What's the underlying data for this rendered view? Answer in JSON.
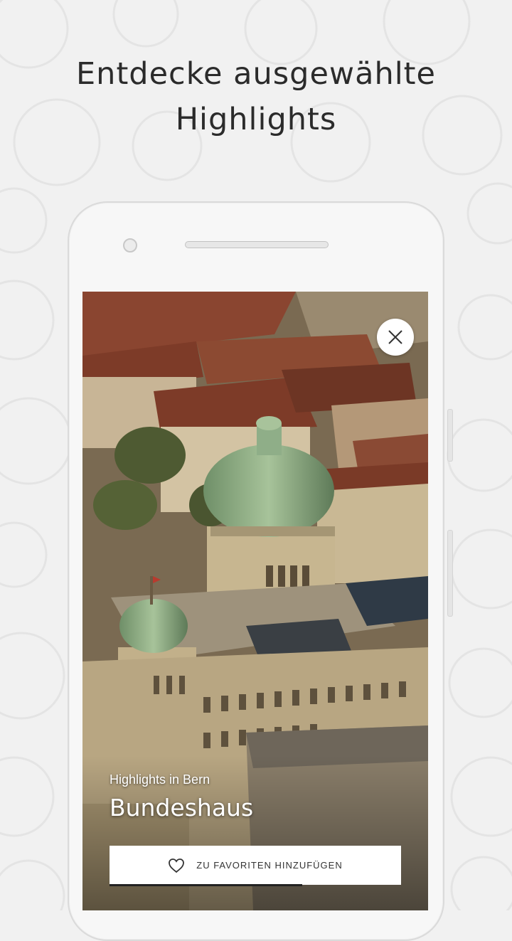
{
  "headline": {
    "line1": "Entdecke ausgewählte",
    "line2": "Highlights"
  },
  "screen": {
    "subtitle": "Highlights in Bern",
    "title": "Bundeshaus",
    "favorite_label": "ZU FAVORITEN HINZUFÜGEN",
    "progress": 0.66,
    "icons": {
      "close": "close-icon",
      "favorite": "heart-icon"
    }
  },
  "colors": {
    "background": "#f1f1f1",
    "text_dark": "#2b2b2b",
    "dome_green": "#8fae88",
    "roof_red": "#7d3b28"
  }
}
